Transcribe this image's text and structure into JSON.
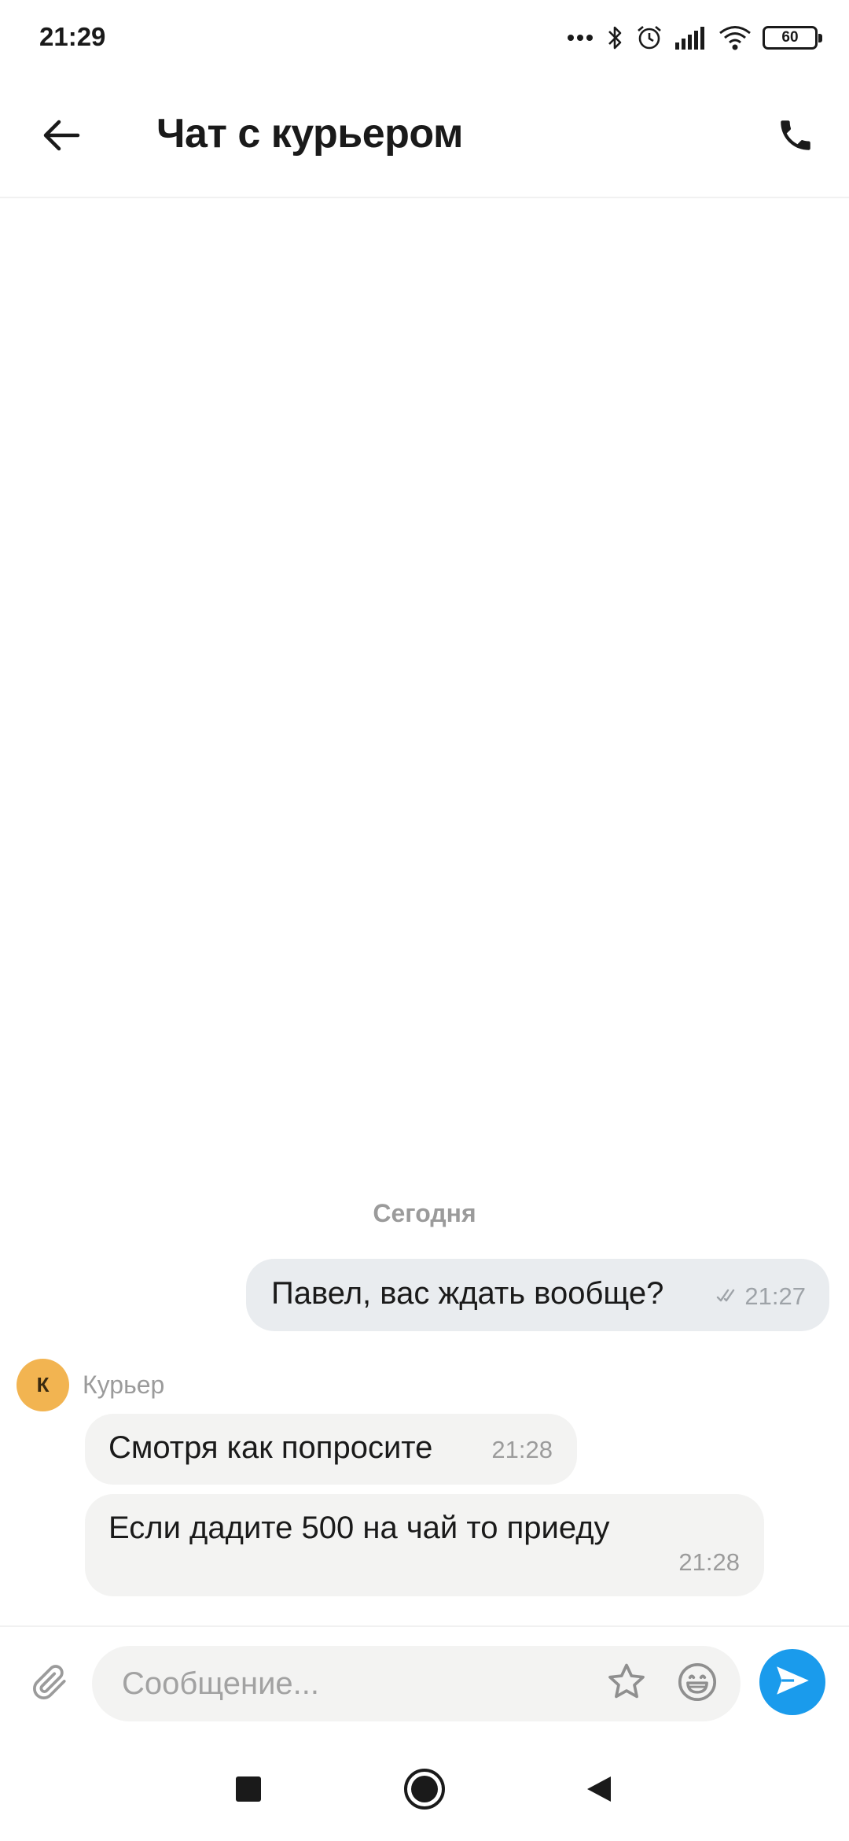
{
  "status_bar": {
    "time": "21:29",
    "battery": "60",
    "icons": [
      "more-dots-icon",
      "bluetooth-icon",
      "alarm-icon",
      "signal-icon",
      "wifi-icon",
      "battery-icon"
    ]
  },
  "header": {
    "title": "Чат с курьером",
    "back_icon": "arrow-left-icon",
    "call_icon": "phone-icon"
  },
  "chat": {
    "date_divider": "Сегодня",
    "outgoing": [
      {
        "text": "Павел, вас ждать вообще?",
        "time": "21:27",
        "status_icon": "double-check-icon"
      }
    ],
    "sender": {
      "initial": "К",
      "name": "Курьер",
      "avatar_color": "#f2b451"
    },
    "incoming": [
      {
        "text": "Смотря как попросите",
        "time": "21:28"
      },
      {
        "text": "Если дадите 500 на чай то приеду",
        "time": "21:28"
      }
    ]
  },
  "composer": {
    "placeholder": "Сообщение...",
    "value": "",
    "attach_icon": "paperclip-icon",
    "star_icon": "star-icon",
    "emoji_icon": "emoji-icon",
    "send_icon": "send-icon"
  },
  "colors": {
    "accent": "#1a9bec",
    "outgoing_bubble": "#e9ecef",
    "incoming_bubble": "#f3f3f2"
  }
}
